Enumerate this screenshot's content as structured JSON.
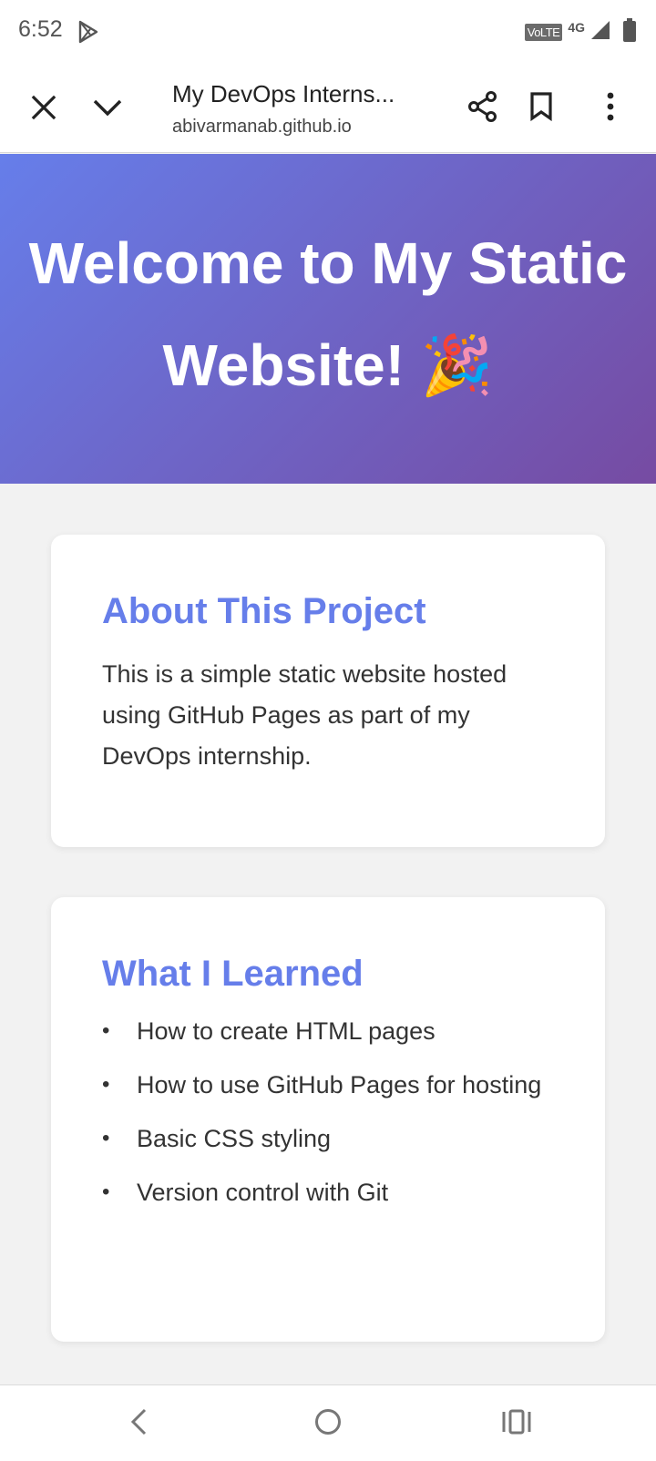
{
  "status_bar": {
    "time": "6:52",
    "volte": "VoLTE",
    "network": "4G",
    "icons": [
      "play-store-icon",
      "signal-icon",
      "battery-icon"
    ]
  },
  "browser": {
    "page_title": "My DevOps Interns...",
    "url": "abivarmanab.github.io",
    "icons": [
      "close-icon",
      "chevron-down-icon",
      "share-icon",
      "bookmark-icon",
      "more-vert-icon"
    ]
  },
  "hero": {
    "title": "Welcome to My Static Website! 🎉",
    "gradient_start": "#667eea",
    "gradient_end": "#764ba2"
  },
  "about": {
    "heading": "About This Project",
    "text": "This is a simple static website hosted using GitHub Pages as part of my DevOps internship."
  },
  "learned": {
    "heading": "What I Learned",
    "items": [
      "How to create HTML pages",
      "How to use GitHub Pages for hosting",
      "Basic CSS styling",
      "Version control with Git"
    ]
  },
  "nav": {
    "icons": [
      "back-icon",
      "home-icon",
      "recents-icon"
    ]
  },
  "colors": {
    "heading": "#667eea",
    "background": "#f2f2f2"
  }
}
